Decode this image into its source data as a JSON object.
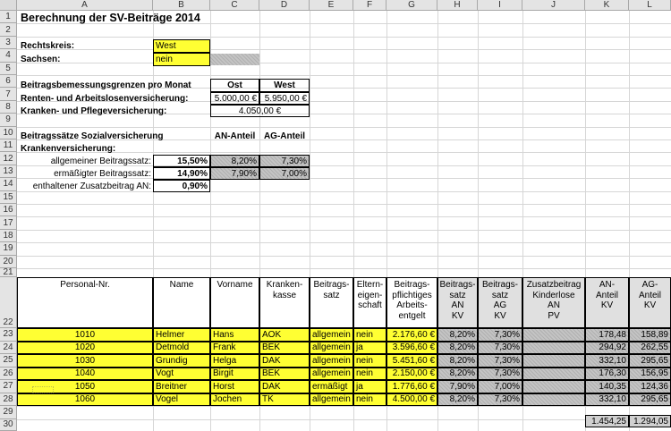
{
  "columns": [
    "A",
    "B",
    "C",
    "D",
    "E",
    "F",
    "G",
    "H",
    "I",
    "J",
    "K",
    "L"
  ],
  "rows": [
    "1",
    "2",
    "3",
    "4",
    "5",
    "6",
    "7",
    "8",
    "9",
    "10",
    "11",
    "12",
    "13",
    "14",
    "15",
    "16",
    "17",
    "18",
    "19",
    "20",
    "21",
    "22",
    "23",
    "24",
    "25",
    "26",
    "27",
    "28",
    "29",
    "30"
  ],
  "title": "Berechnung der SV-Beiträge 2014",
  "rechtskreis": {
    "label": "Rechtskreis:",
    "value": "West"
  },
  "sachsen": {
    "label": "Sachsen:",
    "value": "nein"
  },
  "bbg": {
    "label": "Beitragsbemessungsgrenzen pro Monat",
    "ost": "Ost",
    "west": "West",
    "rv_label": "Renten- und Arbeitslosenversicherung:",
    "rv_ost": "5.000,00 €",
    "rv_west": "5.950,00 €",
    "kv_label": "Kranken- und Pflegeversicherung:",
    "kv_value": "4.050,00 €"
  },
  "saetze": {
    "label": "Beitragssätze Sozialversicherung",
    "an": "AN-Anteil",
    "ag": "AG-Anteil",
    "kv_label": "Krankenversicherung:",
    "allg_label": "allgemeiner Beitragssatz:",
    "allg_value": "15,50%",
    "allg_an": "8,20%",
    "allg_ag": "7,30%",
    "erm_label": "ermäßigter Beitragssatz:",
    "erm_value": "14,90%",
    "erm_an": "7,90%",
    "erm_ag": "7,00%",
    "zus_label": "enthaltener Zusatzbeitrag AN:",
    "zus_value": "0,90%"
  },
  "table": {
    "headers": {
      "personal": "Personal-Nr.",
      "name": "Name",
      "vorname": "Vorname",
      "kk": [
        "Kranken-",
        "kasse"
      ],
      "bs": [
        "Beitrags-",
        "satz"
      ],
      "ee": [
        "Eltern-",
        "eigen-",
        "schaft"
      ],
      "bpa": [
        "Beitrags-",
        "pflichtiges",
        "Arbeits-",
        "entgelt"
      ],
      "bsan": [
        "Beitrags-",
        "satz",
        "AN",
        "KV"
      ],
      "bsag": [
        "Beitrags-",
        "satz",
        "AG",
        "KV"
      ],
      "zus": [
        "Zusatzbeitrag",
        "Kinderlose",
        "AN",
        "PV"
      ],
      "anteil_an": [
        "AN-",
        "Anteil",
        "KV"
      ],
      "anteil_ag": [
        "AG-",
        "Anteil",
        "KV"
      ]
    },
    "rows": [
      {
        "nr": "1010",
        "name": "Helmer",
        "vorname": "Hans",
        "kk": "AOK",
        "bs": "allgemein",
        "ee": "nein",
        "entgelt": "2.176,60 €",
        "an_satz": "8,20%",
        "ag_satz": "7,30%",
        "an_anteil": "178,48",
        "ag_anteil": "158,89"
      },
      {
        "nr": "1020",
        "name": "Detmold",
        "vorname": "Frank",
        "kk": "BEK",
        "bs": "allgemein",
        "ee": "ja",
        "entgelt": "3.596,60 €",
        "an_satz": "8,20%",
        "ag_satz": "7,30%",
        "an_anteil": "294,92",
        "ag_anteil": "262,55"
      },
      {
        "nr": "1030",
        "name": "Grundig",
        "vorname": "Helga",
        "kk": "DAK",
        "bs": "allgemein",
        "ee": "nein",
        "entgelt": "5.451,60 €",
        "an_satz": "8,20%",
        "ag_satz": "7,30%",
        "an_anteil": "332,10",
        "ag_anteil": "295,65"
      },
      {
        "nr": "1040",
        "name": "Vogt",
        "vorname": "Birgit",
        "kk": "BEK",
        "bs": "allgemein",
        "ee": "nein",
        "entgelt": "2.150,00 €",
        "an_satz": "8,20%",
        "ag_satz": "7,30%",
        "an_anteil": "176,30",
        "ag_anteil": "156,95"
      },
      {
        "nr": "1050",
        "name": "Breitner",
        "vorname": "Horst",
        "kk": "DAK",
        "bs": "ermäßigt",
        "ee": "ja",
        "entgelt": "1.776,60 €",
        "an_satz": "7,90%",
        "ag_satz": "7,00%",
        "an_anteil": "140,35",
        "ag_anteil": "124,36"
      },
      {
        "nr": "1060",
        "name": "Vogel",
        "vorname": "Jochen",
        "kk": "TK",
        "bs": "allgemein",
        "ee": "nein",
        "entgelt": "4.500,00 €",
        "an_satz": "8,20%",
        "ag_satz": "7,30%",
        "an_anteil": "332,10",
        "ag_anteil": "295,65"
      }
    ],
    "total_an": "1.454,25",
    "total_ag": "1.294,05"
  },
  "colors": {
    "yellow": "#ffff33",
    "gray": "#c0c0c0",
    "header_bg": "#e4e4e4"
  }
}
